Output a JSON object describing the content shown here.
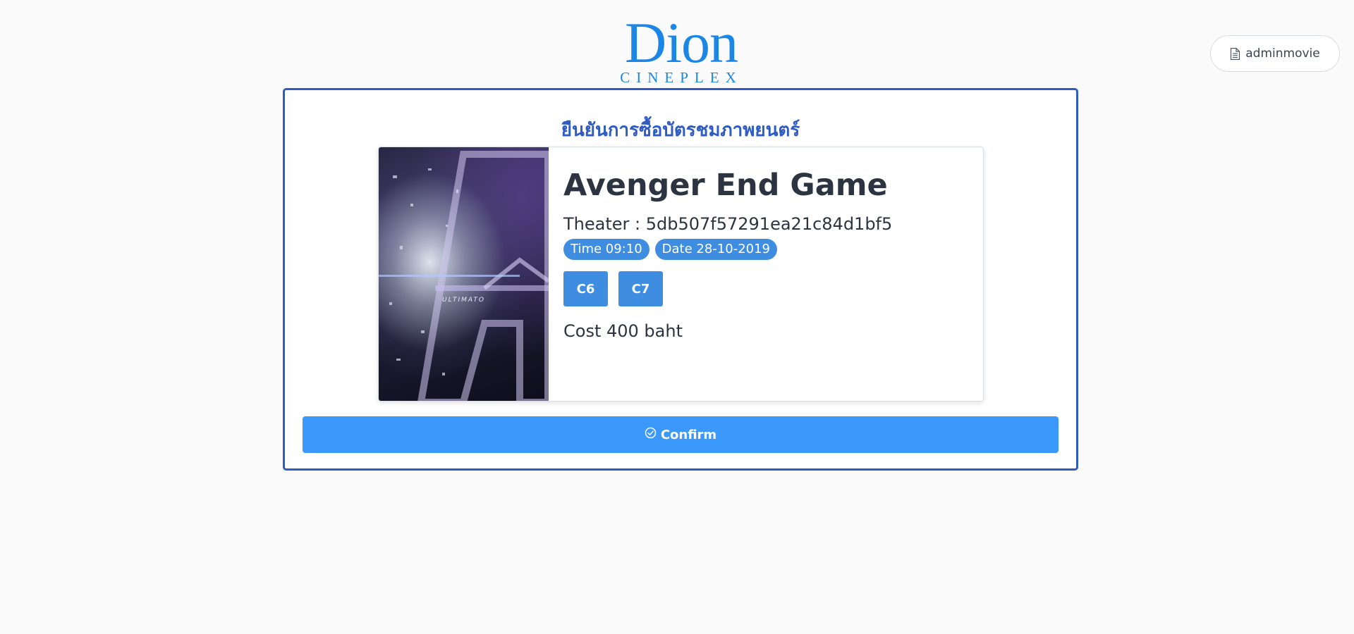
{
  "header": {
    "logo_brand": "Dion",
    "logo_sub": "CINEPLEX",
    "user_label": "adminmovie",
    "user_icon": "document-icon"
  },
  "page": {
    "title": "ยืนยันการซื้อบัตรชมภาพยนตร์"
  },
  "ticket": {
    "poster_text": "ULTIMATO",
    "movie_title": "Avenger End Game",
    "theater": "Theater : 5db507f57291ea21c84d1bf5",
    "time_badge": "Time 09:10",
    "date_badge": "Date 28-10-2019",
    "seats": [
      "C6",
      "C7"
    ],
    "cost": "Cost 400 baht"
  },
  "actions": {
    "confirm_label": "Confirm",
    "confirm_icon": "check-circle-icon"
  },
  "colors": {
    "brand": "#1c86e6",
    "frame_border": "#2e5bc4",
    "badge": "#3f8de0",
    "confirm": "#3b99fc"
  }
}
